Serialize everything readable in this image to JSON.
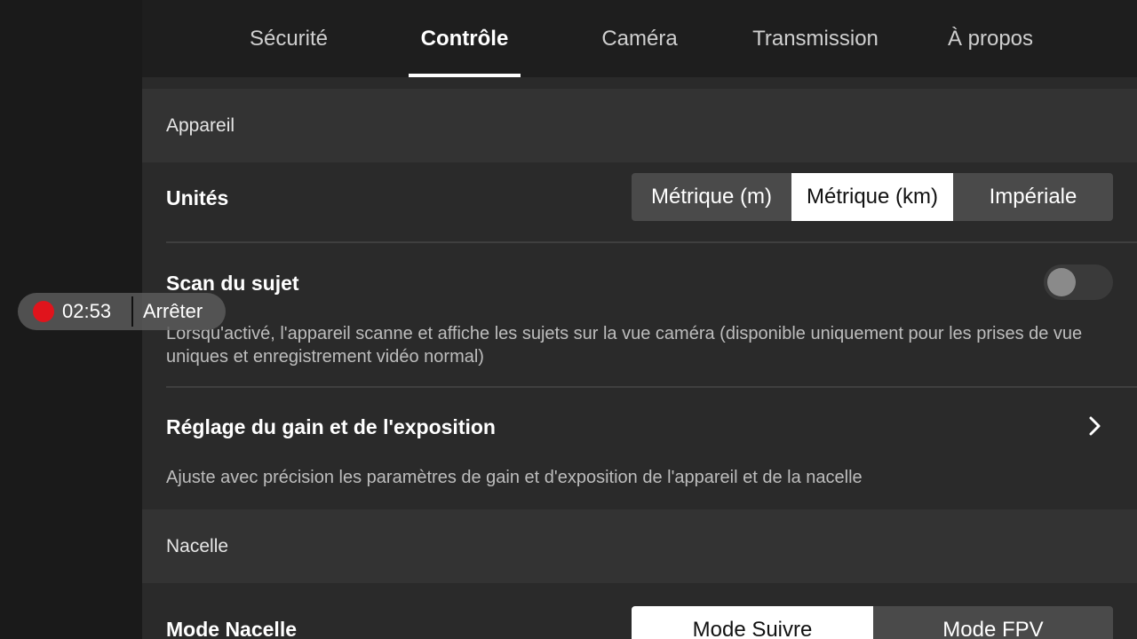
{
  "tabs": [
    {
      "label": "Sécurité",
      "active": false
    },
    {
      "label": "Contrôle",
      "active": true
    },
    {
      "label": "Caméra",
      "active": false
    },
    {
      "label": "Transmission",
      "active": false
    },
    {
      "label": "À propos",
      "active": false
    }
  ],
  "sections": {
    "appareil": {
      "header": "Appareil"
    },
    "nacelle": {
      "header": "Nacelle"
    }
  },
  "units": {
    "title": "Unités",
    "options": [
      "Métrique (m)",
      "Métrique (km)",
      "Impériale"
    ],
    "selected": "Métrique (km)"
  },
  "subject_scan": {
    "title": "Scan du sujet",
    "description": "Lorsqu'activé, l'appareil scanne et affiche les sujets sur la vue caméra (disponible uniquement pour les prises de vue uniques et enregistrement vidéo normal)",
    "enabled": false
  },
  "gain_exposure": {
    "title": "Réglage du gain et de l'exposition",
    "description": "Ajuste avec précision les paramètres de gain et d'exposition de l'appareil et de la nacelle"
  },
  "gimbal_mode": {
    "title": "Mode Nacelle",
    "options": [
      "Mode Suivre",
      "Mode FPV"
    ],
    "selected": "Mode Suivre"
  },
  "recording": {
    "time": "02:53",
    "stop_label": "Arrêter"
  },
  "colors": {
    "record_dot": "#e0141c",
    "panel_bg": "#2a2a2a",
    "tabbar_bg": "#1e1e1e",
    "selected_segment": "#ffffff"
  },
  "icons": {
    "chevron": "chevron-right-icon"
  }
}
